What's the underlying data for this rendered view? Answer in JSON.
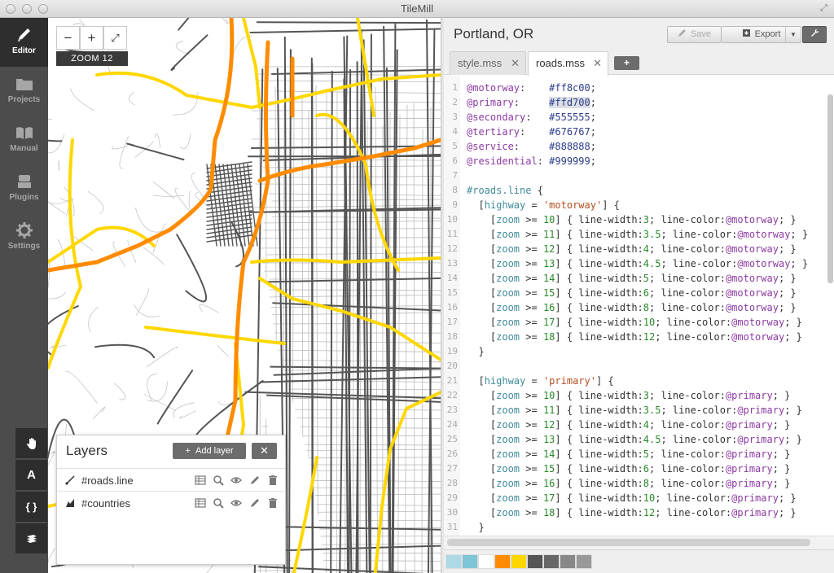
{
  "window": {
    "title": "TileMill"
  },
  "nav": {
    "items": [
      {
        "label": "Editor",
        "icon": "pencil-icon",
        "active": true
      },
      {
        "label": "Projects",
        "icon": "folder-icon",
        "active": false
      },
      {
        "label": "Manual",
        "icon": "book-icon",
        "active": false
      },
      {
        "label": "Plugins",
        "icon": "plugin-icon",
        "active": false
      },
      {
        "label": "Settings",
        "icon": "gear-icon",
        "active": false
      }
    ],
    "tools": [
      {
        "name": "pan-tool",
        "icon": "hand-icon"
      },
      {
        "name": "font-tool",
        "label": "A",
        "icon": "font-icon"
      },
      {
        "name": "carto-tool",
        "label": "{ }",
        "icon": "braces-icon"
      },
      {
        "name": "layers-tool",
        "icon": "layers-icon"
      }
    ]
  },
  "map": {
    "zoom_out": "−",
    "zoom_in": "+",
    "fullscreen_icon": "expand-icon",
    "zoom_label": "ZOOM 12"
  },
  "layers_panel": {
    "title": "Layers",
    "add_label": "Add layer",
    "close_label": "✕",
    "layers": [
      {
        "name": "#roads.line",
        "icon": "line-geometry-icon"
      },
      {
        "name": "#countries",
        "icon": "polygon-geometry-icon"
      }
    ]
  },
  "editor": {
    "project_title": "Portland, OR",
    "save_label": "Save",
    "export_label": "Export",
    "tabs": [
      {
        "label": "style.mss",
        "close": "✕",
        "active": false
      },
      {
        "label": "roads.mss",
        "close": "✕",
        "active": true
      }
    ],
    "add_tab": "+",
    "code_lines": [
      "@motorway:    #ff8c00;",
      "@primary:     #ffd700;",
      "@secondary:   #555555;",
      "@tertiary:    #676767;",
      "@service:     #888888;",
      "@residential: #999999;",
      "",
      "#roads.line {",
      "  [highway = 'motorway'] {",
      "    [zoom >= 10] { line-width:3; line-color:@motorway; }",
      "    [zoom >= 11] { line-width:3.5; line-color:@motorway; }",
      "    [zoom >= 12] { line-width:4; line-color:@motorway; }",
      "    [zoom >= 13] { line-width:4.5; line-color:@motorway; }",
      "    [zoom >= 14] { line-width:5; line-color:@motorway; }",
      "    [zoom >= 15] { line-width:6; line-color:@motorway; }",
      "    [zoom >= 16] { line-width:8; line-color:@motorway; }",
      "    [zoom >= 17] { line-width:10; line-color:@motorway; }",
      "    [zoom >= 18] { line-width:12; line-color:@motorway; }",
      "  }",
      "",
      "  [highway = 'primary'] {",
      "    [zoom >= 10] { line-width:3; line-color:@primary; }",
      "    [zoom >= 11] { line-width:3.5; line-color:@primary; }",
      "    [zoom >= 12] { line-width:4; line-color:@primary; }",
      "    [zoom >= 13] { line-width:4.5; line-color:@primary; }",
      "    [zoom >= 14] { line-width:5; line-color:@primary; }",
      "    [zoom >= 15] { line-width:6; line-color:@primary; }",
      "    [zoom >= 16] { line-width:8; line-color:@primary; }",
      "    [zoom >= 17] { line-width:10; line-color:@primary; }",
      "    [zoom >= 18] { line-width:12; line-color:@primary; }",
      "  }",
      ""
    ],
    "highlight_line": 2,
    "palette": [
      "#add8e6",
      "#7ec5d8",
      "#ffffff",
      "#ff8c00",
      "#ffd700",
      "#555555",
      "#676767",
      "#888888",
      "#999999"
    ]
  },
  "colors": {
    "motorway": "#ff8c00",
    "primary": "#ffd700",
    "road_dark": "#555555",
    "road_light": "#999999"
  }
}
